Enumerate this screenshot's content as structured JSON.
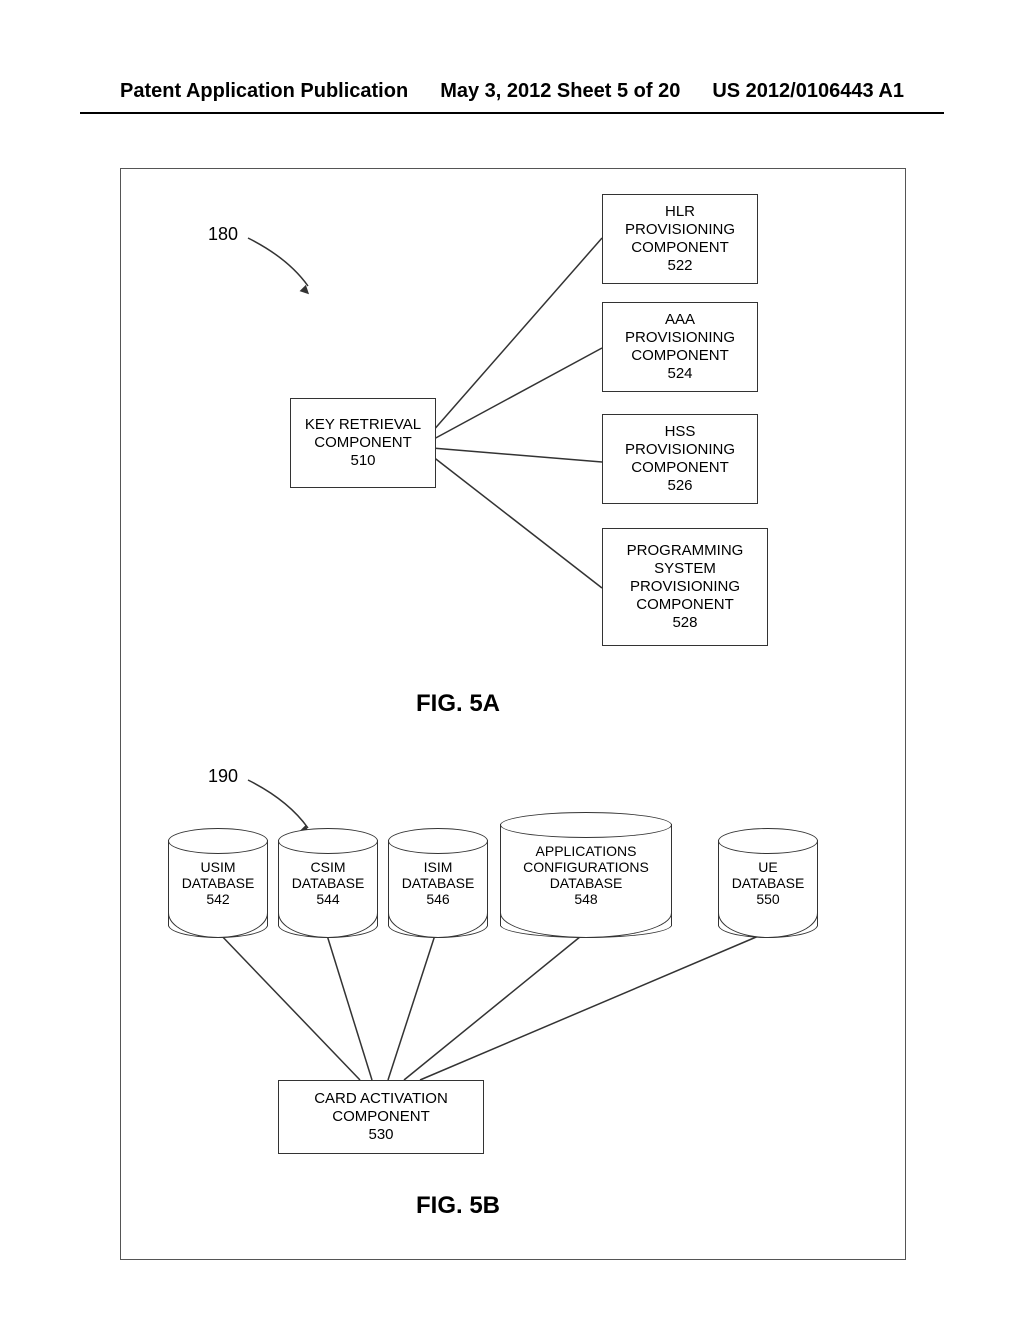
{
  "header": {
    "left": "Patent Application Publication",
    "center": "May 3, 2012  Sheet 5 of 20",
    "right": "US 2012/0106443 A1"
  },
  "figA": {
    "ref": "180",
    "boxes": {
      "key": {
        "text": "KEY RETRIEVAL\nCOMPONENT\n510"
      },
      "hlr": {
        "text": "HLR\nPROVISIONING\nCOMPONENT\n522"
      },
      "aaa": {
        "text": "AAA\nPROVISIONING\nCOMPONENT\n524"
      },
      "hss": {
        "text": "HSS\nPROVISIONING\nCOMPONENT\n526"
      },
      "prog": {
        "text": "PROGRAMMING\nSYSTEM\nPROVISIONING\nCOMPONENT\n528"
      }
    },
    "label": "FIG. 5A"
  },
  "figB": {
    "ref": "190",
    "dbs": {
      "usim": {
        "text": "USIM\nDATABASE\n542"
      },
      "csim": {
        "text": "CSIM\nDATABASE\n544"
      },
      "isim": {
        "text": "ISIM\nDATABASE\n546"
      },
      "apps": {
        "text": "APPLICATIONS\nCONFIGURATIONS\nDATABASE\n548"
      },
      "ue": {
        "text": "UE\nDATABASE\n550"
      }
    },
    "card": {
      "text": "CARD ACTIVATION\nCOMPONENT\n530"
    },
    "label": "FIG. 5B"
  }
}
